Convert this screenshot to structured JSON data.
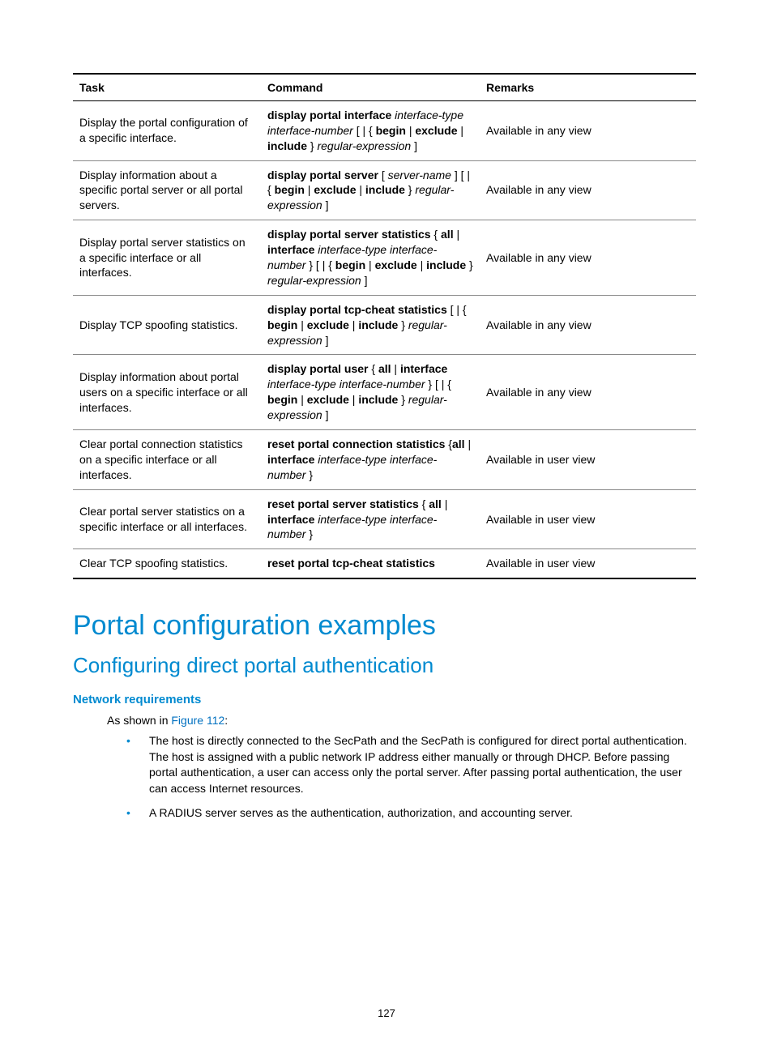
{
  "table": {
    "headers": [
      "Task",
      "Command",
      "Remarks"
    ],
    "rows": [
      {
        "task": "Display the portal configuration of a specific interface.",
        "cmd": [
          {
            "b": "display portal interface "
          },
          {
            "i": "interface-type interface-number"
          },
          {
            "t": " [ | { "
          },
          {
            "b": "begin"
          },
          {
            "t": " | "
          },
          {
            "b": "exclude"
          },
          {
            "t": " | "
          },
          {
            "b": "include"
          },
          {
            "t": " } "
          },
          {
            "i": "regular-expression"
          },
          {
            "t": " ]"
          }
        ],
        "remarks": "Available in any view"
      },
      {
        "task": "Display information about a specific portal server or all portal servers.",
        "cmd": [
          {
            "b": "display portal server"
          },
          {
            "t": " [ "
          },
          {
            "i": "server-name"
          },
          {
            "t": " ] [ | { "
          },
          {
            "b": "begin"
          },
          {
            "t": " | "
          },
          {
            "b": "exclude"
          },
          {
            "t": " | "
          },
          {
            "b": "include"
          },
          {
            "t": " } "
          },
          {
            "i": "regular-expression"
          },
          {
            "t": " ]"
          }
        ],
        "remarks": "Available in any view"
      },
      {
        "task": "Display portal server statistics on a specific interface or all interfaces.",
        "cmd": [
          {
            "b": "display portal server statistics"
          },
          {
            "t": " { "
          },
          {
            "b": "all"
          },
          {
            "t": " | "
          },
          {
            "b": "interface"
          },
          {
            "t": " "
          },
          {
            "i": "interface-type interface-number"
          },
          {
            "t": " } [ | { "
          },
          {
            "b": "begin"
          },
          {
            "t": " | "
          },
          {
            "b": "exclude"
          },
          {
            "t": " | "
          },
          {
            "b": "include"
          },
          {
            "t": " } "
          },
          {
            "i": "regular-expression"
          },
          {
            "t": " ]"
          }
        ],
        "remarks": "Available in any view"
      },
      {
        "task": "Display TCP spoofing statistics.",
        "cmd": [
          {
            "b": "display portal tcp-cheat statistics"
          },
          {
            "t": " [ | { "
          },
          {
            "b": "begin"
          },
          {
            "t": " | "
          },
          {
            "b": "exclude"
          },
          {
            "t": " | "
          },
          {
            "b": "include"
          },
          {
            "t": " } "
          },
          {
            "i": "regular-expression"
          },
          {
            "t": " ]"
          }
        ],
        "remarks": "Available in any view"
      },
      {
        "task": "Display information about portal users on a specific interface or all interfaces.",
        "cmd": [
          {
            "b": "display portal user"
          },
          {
            "t": " { "
          },
          {
            "b": "all"
          },
          {
            "t": " | "
          },
          {
            "b": "interface"
          },
          {
            "t": " "
          },
          {
            "i": "interface-type interface-number"
          },
          {
            "t": " } [ | { "
          },
          {
            "b": "begin"
          },
          {
            "t": " | "
          },
          {
            "b": "exclude"
          },
          {
            "t": " | "
          },
          {
            "b": "include"
          },
          {
            "t": " } "
          },
          {
            "i": "regular-expression"
          },
          {
            "t": " ]"
          }
        ],
        "remarks": "Available in any view"
      },
      {
        "task": "Clear portal connection statistics on a specific interface or all interfaces.",
        "cmd": [
          {
            "b": "reset portal connection statistics"
          },
          {
            "t": " {"
          },
          {
            "b": "all"
          },
          {
            "t": " | "
          },
          {
            "b": "interface"
          },
          {
            "t": " "
          },
          {
            "i": "interface-type interface-number"
          },
          {
            "t": " }"
          }
        ],
        "remarks": "Available in user view"
      },
      {
        "task": "Clear portal server statistics on a specific interface or all interfaces.",
        "cmd": [
          {
            "b": "reset portal server statistics"
          },
          {
            "t": " { "
          },
          {
            "b": "all"
          },
          {
            "t": " | "
          },
          {
            "b": "interface"
          },
          {
            "t": " "
          },
          {
            "i": "interface-type interface-number"
          },
          {
            "t": " }"
          }
        ],
        "remarks": "Available in user view"
      },
      {
        "task": "Clear TCP spoofing statistics.",
        "cmd": [
          {
            "b": "reset portal tcp-cheat statistics"
          }
        ],
        "remarks": "Available in user view"
      }
    ]
  },
  "h1": "Portal configuration examples",
  "h2": "Configuring direct portal authentication",
  "h3": "Network requirements",
  "intro_prefix": "As shown in ",
  "intro_link": "Figure 112",
  "intro_suffix": ":",
  "bullets": [
    "The host is directly connected to the SecPath and the SecPath is configured for direct portal authentication. The host is assigned with a public network IP address either manually or through DHCP. Before passing portal authentication, a user can access only the portal server. After passing portal authentication, the user can access Internet resources.",
    "A RADIUS server serves as the authentication, authorization, and accounting server."
  ],
  "page_number": "127"
}
